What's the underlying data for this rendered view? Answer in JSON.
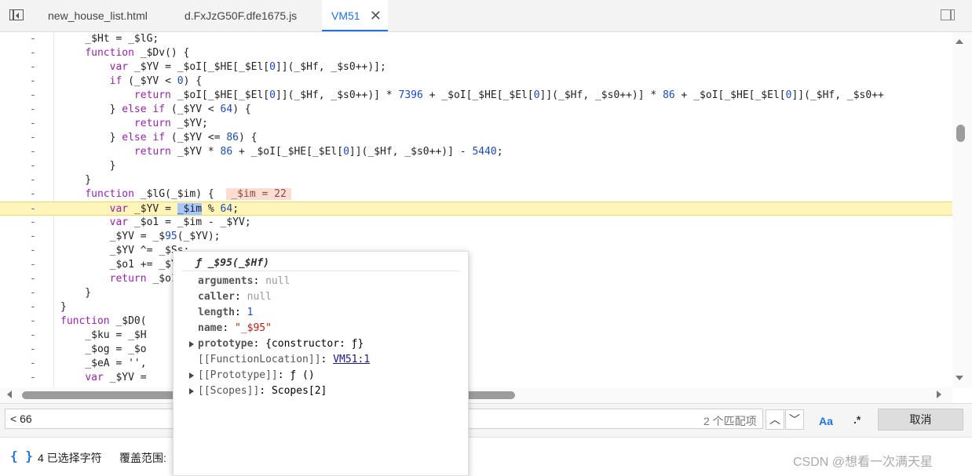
{
  "tabs": [
    {
      "label": "new_house_list.html",
      "active": false
    },
    {
      "label": "d.FxJzG50F.dfe1675.js",
      "active": false
    },
    {
      "label": "VM51",
      "active": true
    }
  ],
  "code": {
    "gutter_marker": "-",
    "lines": [
      "    _$Ht = _$lG;",
      "    function _$Dv() {",
      "        var _$YV = _$oI[_$HE[_$El[0]](_$Hf, _$s0++)];",
      "        if (_$YV < 0) {",
      "            return _$oI[_$HE[_$El[0]](_$Hf, _$s0++)] * 7396 + _$oI[_$HE[_$El[0]](_$Hf, _$s0++)] * 86 + _$oI[_$HE[_$El[0]](_$Hf, _$s0++",
      "        } else if (_$YV < 64) {",
      "            return _$YV;",
      "        } else if (_$YV <= 86) {",
      "            return _$YV * 86 + _$oI[_$HE[_$El[0]](_$Hf, _$s0++)] - 5440;",
      "        }",
      "    }",
      "    function _$lG(_$im) {",
      "        var _$YV = _$im % 64;",
      "        var _$o1 = _$im - _$YV;",
      "        _$YV = _$95(_$YV);",
      "        _$YV ^= _$Ss;",
      "        _$o1 += _$YV;",
      "        return _$o1;",
      "    }",
      "}",
      "function _$D0(",
      "    _$ku = _$H",
      "    _$og = _$o",
      "    _$eA = '',",
      "    var _$YV ="
    ],
    "inline_value": "_$im = 22",
    "highlighted_line_index": 12
  },
  "popover": {
    "title": "ƒ _$95(_$Hf)",
    "rows": [
      {
        "key": "arguments",
        "value": "null",
        "kind": "null"
      },
      {
        "key": "caller",
        "value": "null",
        "kind": "null"
      },
      {
        "key": "length",
        "value": "1",
        "kind": "num"
      },
      {
        "key": "name",
        "value": "\"_$95\"",
        "kind": "str"
      },
      {
        "key": "prototype",
        "value": "{constructor: ƒ}",
        "kind": "obj",
        "expandable": true
      },
      {
        "key": "[[FunctionLocation]]",
        "value": "VM51:1",
        "kind": "link"
      },
      {
        "key": "[[Prototype]]",
        "value": "ƒ ()",
        "kind": "obj",
        "expandable": true
      },
      {
        "key": "[[Scopes]]",
        "value": "Scopes[2]",
        "kind": "obj",
        "expandable": true
      }
    ]
  },
  "search": {
    "value": "< 66",
    "match_count": "2 个匹配项",
    "case_label": "Aa",
    "regex_label": ".*",
    "cancel_label": "取消"
  },
  "status": {
    "braces": "{ }",
    "selected": "4 已选择字符",
    "coverage": "覆盖范围:",
    "watermark": "CSDN @想看一次满天星"
  }
}
